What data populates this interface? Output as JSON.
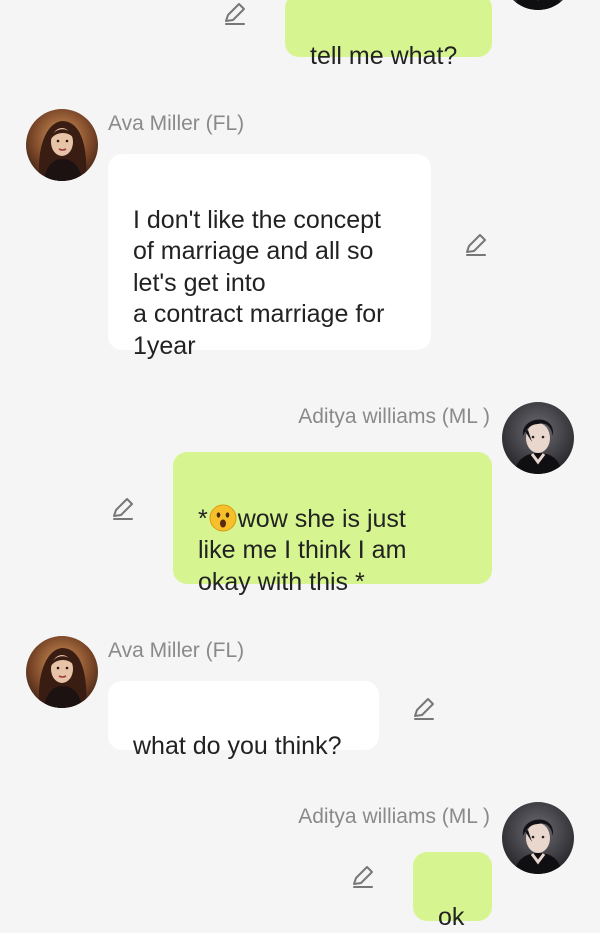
{
  "participants": {
    "female": {
      "name": "Ava Miller (FL)"
    },
    "male": {
      "name": "Aditya williams (ML )"
    }
  },
  "messages": [
    {
      "sender": "male",
      "text": "tell me what?"
    },
    {
      "sender": "female",
      "name": "Ava Miller (FL)",
      "text": "I don't like the concept\nof marriage and all so\nlet's get into\na contract marriage for\n1year"
    },
    {
      "sender": "male",
      "name": "Aditya williams (ML )",
      "text_before_emoji": "*",
      "emoji": "astonished-face-emoji",
      "text_after_emoji": "wow she is just\nlike me I think I am\nokay with this *"
    },
    {
      "sender": "female",
      "name": "Ava Miller (FL)",
      "text": "what do you think?"
    },
    {
      "sender": "male",
      "name": "Aditya williams (ML )",
      "text": "ok"
    }
  ],
  "icons": {
    "edit": "pencil-edit-icon",
    "avatar_female": "avatar-ava",
    "avatar_male": "avatar-aditya"
  },
  "colors": {
    "background": "#f5f5f5",
    "sent_bubble": "#d6f590",
    "received_bubble": "#ffffff",
    "name_text": "#8a8a8a",
    "icon": "#777777"
  }
}
